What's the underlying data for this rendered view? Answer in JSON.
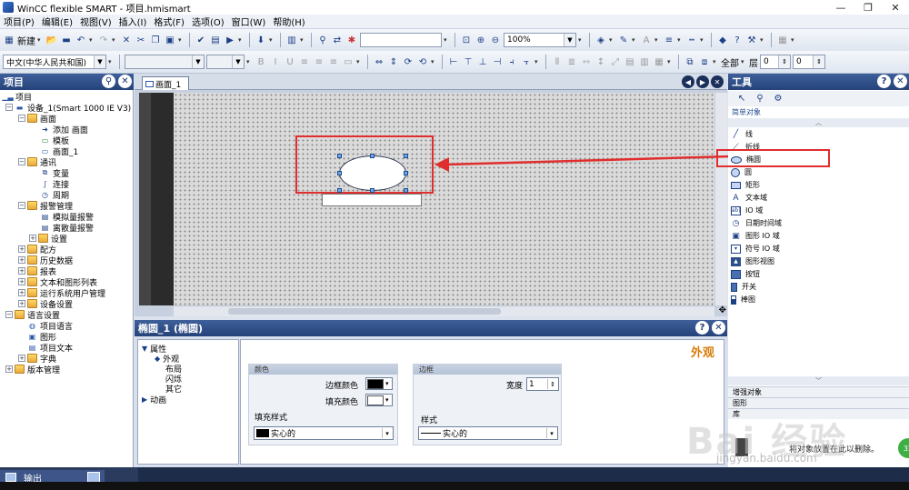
{
  "window": {
    "title": "WinCC flexible SMART - 项目.hmismart",
    "controls": {
      "minimize": "—",
      "maximize": "❐",
      "close": "✕"
    }
  },
  "menu": [
    "项目(P)",
    "编辑(E)",
    "视图(V)",
    "插入(I)",
    "格式(F)",
    "选项(O)",
    "窗口(W)",
    "帮助(H)"
  ],
  "toolbar1": {
    "new_label": "新建",
    "zoom_value": "100%",
    "style_combo_value": ""
  },
  "toolbar2": {
    "language_value": "中文(中华人民共和国)",
    "all_label": "全部",
    "layer_label": "层",
    "layer_value_1": "0",
    "layer_value_2": "0"
  },
  "project_panel": {
    "title": "项目",
    "items": [
      {
        "label": "项目",
        "level": 0
      },
      {
        "label": "设备_1(Smart 1000 IE V3)",
        "level": 1
      },
      {
        "label": "画面",
        "level": 2
      },
      {
        "label": "添加 画面",
        "level": 3
      },
      {
        "label": "模板",
        "level": 3
      },
      {
        "label": "画面_1",
        "level": 3
      },
      {
        "label": "通讯",
        "level": 2
      },
      {
        "label": "变量",
        "level": 3
      },
      {
        "label": "连接",
        "level": 3
      },
      {
        "label": "周期",
        "level": 3
      },
      {
        "label": "报警管理",
        "level": 2
      },
      {
        "label": "模拟量报警",
        "level": 3
      },
      {
        "label": "离散量报警",
        "level": 3
      },
      {
        "label": "设置",
        "level": 3
      },
      {
        "label": "配方",
        "level": 2
      },
      {
        "label": "历史数据",
        "level": 2
      },
      {
        "label": "报表",
        "level": 2
      },
      {
        "label": "文本和图形列表",
        "level": 2
      },
      {
        "label": "运行系统用户管理",
        "level": 2
      },
      {
        "label": "设备设置",
        "level": 2
      },
      {
        "label": "语言设置",
        "level": 1
      },
      {
        "label": "项目语言",
        "level": 2
      },
      {
        "label": "图形",
        "level": 2
      },
      {
        "label": "项目文本",
        "level": 2
      },
      {
        "label": "字典",
        "level": 2
      },
      {
        "label": "版本管理",
        "level": 1
      }
    ]
  },
  "editor": {
    "tab_label": "画面_1"
  },
  "properties": {
    "title": "椭圆_1 (椭圆)",
    "section_heading": "外观",
    "nav": {
      "properties": "属性",
      "appearance": "外观",
      "layout": "布局",
      "flashing": "闪烁",
      "other": "其它",
      "animation": "动画"
    },
    "color_group": "颜色",
    "border_color_label": "边框颜色",
    "fill_color_label": "填充颜色",
    "fill_style_label": "填充样式",
    "fill_style_value": "实心的",
    "border_group": "边框",
    "width_label": "宽度",
    "width_value": "1",
    "style_label": "样式",
    "style_value": "实心的",
    "border_color": "#000000",
    "fill_color": "#ffffff"
  },
  "tools_panel": {
    "title": "工具",
    "simple_objects_header": "简单对象",
    "items": [
      {
        "label": "线",
        "icon": "line-icon"
      },
      {
        "label": "折线",
        "icon": "polyline-icon"
      },
      {
        "label": "椭圆",
        "icon": "ellipse-icon"
      },
      {
        "label": "圆",
        "icon": "circle-icon"
      },
      {
        "label": "矩形",
        "icon": "rectangle-icon"
      },
      {
        "label": "文本域",
        "icon": "text-field-icon"
      },
      {
        "label": "IO 域",
        "icon": "io-field-icon"
      },
      {
        "label": "日期时间域",
        "icon": "datetime-icon"
      },
      {
        "label": "图形 IO 域",
        "icon": "graphic-io-icon"
      },
      {
        "label": "符号 IO 域",
        "icon": "symbolic-io-icon"
      },
      {
        "label": "图形视图",
        "icon": "graphic-view-icon"
      },
      {
        "label": "按钮",
        "icon": "button-icon"
      },
      {
        "label": "开关",
        "icon": "switch-icon"
      },
      {
        "label": "棒图",
        "icon": "bar-icon"
      }
    ],
    "sections": [
      "增强对象",
      "图形",
      "库"
    ],
    "library_message": "将对象放置在此以删除。"
  },
  "output": {
    "label": "输出"
  },
  "watermark": {
    "text": "Bai 经验",
    "sub": "jingyan.baidu.com"
  },
  "colors": {
    "panel_title": "#2d4b84",
    "highlight_red": "#e02d2d",
    "accent_orange": "#d97d0b"
  }
}
